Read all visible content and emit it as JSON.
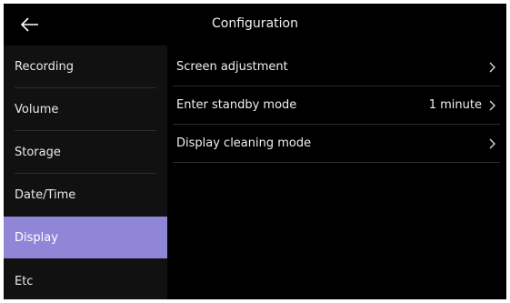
{
  "header": {
    "title": "Configuration",
    "back_icon": "arrow-left-icon"
  },
  "sidebar": {
    "items": [
      {
        "label": "Recording"
      },
      {
        "label": "Volume"
      },
      {
        "label": "Storage"
      },
      {
        "label": "Date/Time"
      },
      {
        "label": "Display",
        "selected": true
      },
      {
        "label": "Etc"
      }
    ],
    "active_color": "#8f86d8"
  },
  "main": {
    "rows": [
      {
        "label": "Screen adjustment",
        "value": ""
      },
      {
        "label": "Enter standby mode",
        "value": "1 minute"
      },
      {
        "label": "Display cleaning mode",
        "value": ""
      }
    ],
    "chevron_icon": "chevron-right-icon"
  },
  "colors": {
    "background": "#000000",
    "sidebar": "#111111",
    "accent": "#8f86d8"
  }
}
